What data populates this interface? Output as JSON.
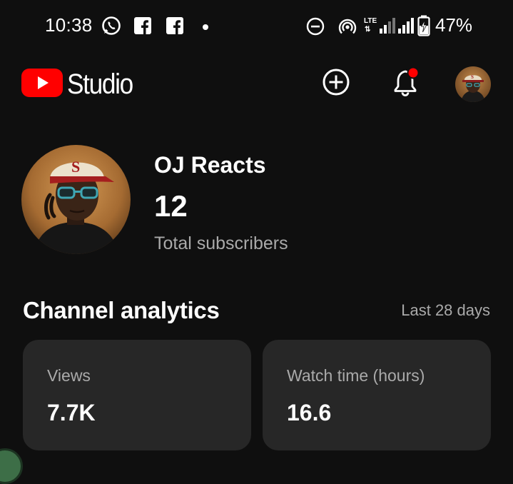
{
  "status_bar": {
    "time": "10:38",
    "battery_percent": "47%",
    "icons": [
      "whatsapp-icon",
      "facebook-icon",
      "facebook-icon",
      "notification-dot",
      "do-not-disturb-icon",
      "hotspot-icon",
      "lte-signal-icon",
      "signal-icon",
      "battery-charging-icon"
    ]
  },
  "header": {
    "logo_text": "Studio",
    "brand_color": "#ff0000",
    "icons": [
      "create-icon",
      "notifications-icon",
      "account-avatar"
    ],
    "notification_badge_color": "#ff0000"
  },
  "profile": {
    "channel_name": "OJ Reacts",
    "subscriber_count": "12",
    "subscriber_label": "Total subscribers"
  },
  "analytics": {
    "title": "Channel analytics",
    "range": "Last 28 days",
    "cards": [
      {
        "label": "Views",
        "value": "7.7K"
      },
      {
        "label": "Watch time (hours)",
        "value": "16.6"
      }
    ]
  }
}
